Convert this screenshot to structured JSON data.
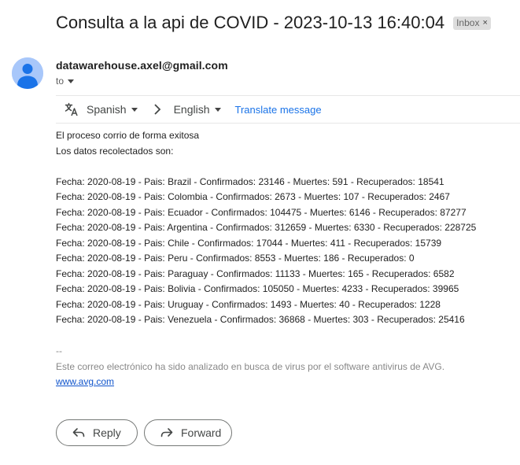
{
  "email": {
    "subject": "Consulta a la api de COVID - 2023-10-13 16:40:04",
    "label": "Inbox",
    "label_remove": "×",
    "sender": "datawarehouse.axel@gmail.com",
    "recipient_label": "to"
  },
  "translate": {
    "source_language": "Spanish",
    "target_language": "English",
    "action": "Translate message"
  },
  "body": {
    "intro": [
      "El proceso corrio de forma exitosa",
      "Los datos recolectados son:"
    ],
    "records": [
      "Fecha: 2020-08-19 - Pais: Brazil - Confirmados: 23146 - Muertes: 591 - Recuperados: 18541",
      "Fecha: 2020-08-19 - Pais: Colombia - Confirmados: 2673 - Muertes: 107 - Recuperados: 2467",
      "Fecha: 2020-08-19 - Pais: Ecuador - Confirmados: 104475 - Muertes: 6146 - Recuperados: 87277",
      "Fecha: 2020-08-19 - Pais: Argentina - Confirmados: 312659 - Muertes: 6330 - Recuperados: 228725",
      "Fecha: 2020-08-19 - Pais: Chile - Confirmados: 17044 - Muertes: 411 - Recuperados: 15739",
      "Fecha: 2020-08-19 - Pais: Peru - Confirmados: 8553 - Muertes: 186 - Recuperados: 0",
      "Fecha: 2020-08-19 - Pais: Paraguay - Confirmados: 11133 - Muertes: 165 - Recuperados: 6582",
      "Fecha: 2020-08-19 - Pais: Bolivia - Confirmados: 105050 - Muertes: 4233 - Recuperados: 39965",
      "Fecha: 2020-08-19 - Pais: Uruguay - Confirmados: 1493 - Muertes: 40 - Recuperados: 1228",
      "Fecha: 2020-08-19 - Pais: Venezuela - Confirmados: 36868 - Muertes: 303 - Recuperados: 25416"
    ]
  },
  "signature": {
    "separator": "--",
    "antivirus_note": "Este correo electrónico ha sido analizado en busca de virus por el software antivirus de AVG.",
    "link": "www.avg.com"
  },
  "actions": {
    "reply": "Reply",
    "forward": "Forward"
  },
  "icons": {
    "avatar": "person-avatar-icon",
    "translate": "translate-icon",
    "arrow": "chevron-right-icon",
    "reply": "reply-icon",
    "forward": "forward-icon"
  },
  "colors": {
    "link": "#1a73e8",
    "avatar_bg": "#a8c7fa",
    "avatar_fg": "#1a73e8"
  }
}
